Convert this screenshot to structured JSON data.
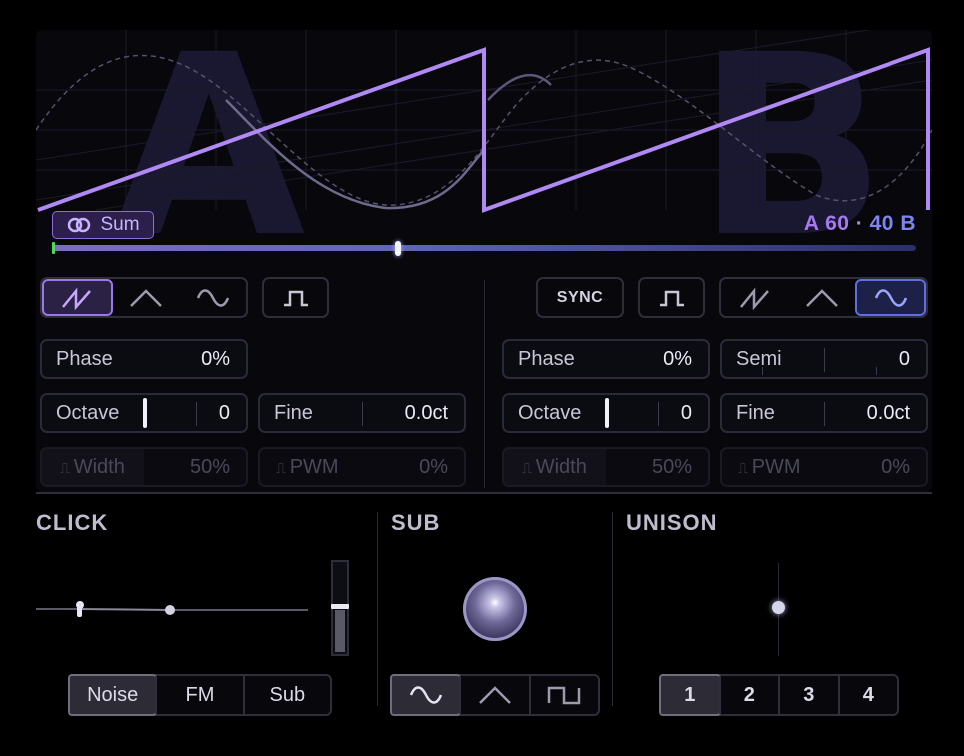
{
  "osc_display": {
    "letter_a": "A",
    "letter_b": "B",
    "mix_mode_label": "Sum",
    "mix_label_a": "A",
    "mix_value_a": "60",
    "mix_sep": "·",
    "mix_value_b": "40",
    "mix_label_b": "B",
    "mix_fraction": 0.4,
    "colors": {
      "accent": "#a679ee",
      "b_accent": "#7e84f0",
      "waveform": "#b089f5"
    }
  },
  "osc_a": {
    "shapes": [
      "saw-icon",
      "triangle-icon",
      "sine-icon"
    ],
    "active_shape": "saw",
    "pulse": "square-pulse-icon",
    "phase": {
      "label": "Phase",
      "value": "0%"
    },
    "octave": {
      "label": "Octave",
      "value": "0"
    },
    "fine": {
      "label": "Fine",
      "value": "0.0ct"
    },
    "width": {
      "label": "Width",
      "value": "50%"
    },
    "pwm": {
      "label": "PWM",
      "value": "0%"
    }
  },
  "osc_b": {
    "sync_label": "SYNC",
    "pulse": "square-pulse-icon",
    "shapes": [
      "saw-icon",
      "triangle-icon",
      "sine-icon"
    ],
    "active_shape": "sine",
    "phase": {
      "label": "Phase",
      "value": "0%"
    },
    "semi": {
      "label": "Semi",
      "value": "0"
    },
    "octave": {
      "label": "Octave",
      "value": "0"
    },
    "fine": {
      "label": "Fine",
      "value": "0.0ct"
    },
    "width": {
      "label": "Width",
      "value": "50%"
    },
    "pwm": {
      "label": "PWM",
      "value": "0%"
    }
  },
  "click": {
    "title": "CLICK",
    "modes": [
      "Noise",
      "FM",
      "Sub"
    ],
    "active_mode": "Noise",
    "level": 0.5
  },
  "sub": {
    "title": "SUB",
    "shapes": [
      "sine-icon",
      "triangle-icon",
      "square-icon"
    ],
    "active_shape": "sine"
  },
  "unison": {
    "title": "UNISON",
    "voices": [
      "1",
      "2",
      "3",
      "4"
    ],
    "active_voice": "1"
  }
}
